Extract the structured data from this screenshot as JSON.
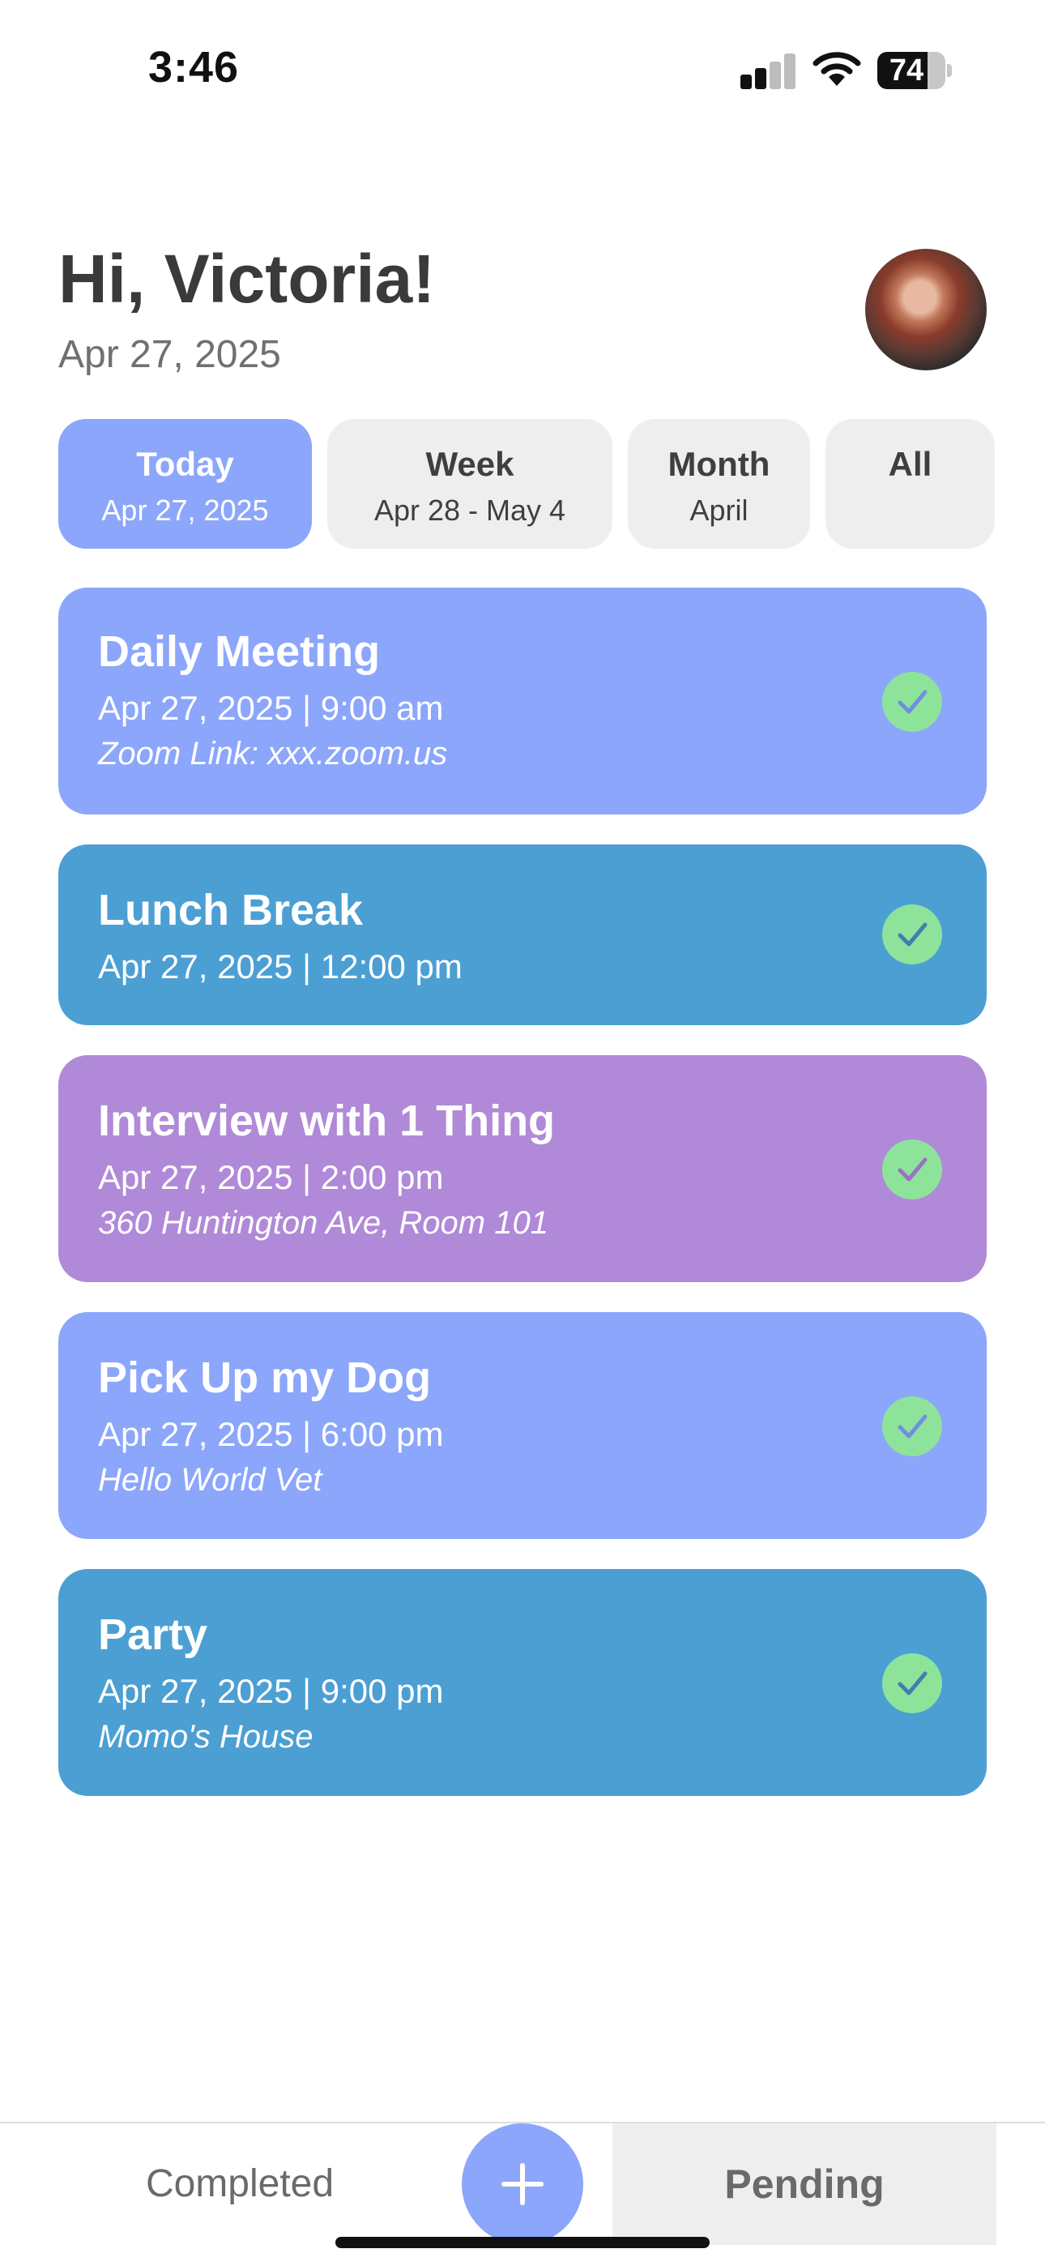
{
  "status_bar": {
    "time": "3:46",
    "battery": "74",
    "battery_level": 0.74
  },
  "header": {
    "greeting": "Hi, Victoria!",
    "date": "Apr 27, 2025"
  },
  "tabs": [
    {
      "label": "Today",
      "sub": "Apr 27, 2025",
      "active": true
    },
    {
      "label": "Week",
      "sub": "Apr 28 - May 4",
      "active": false
    },
    {
      "label": "Month",
      "sub": "April",
      "active": false
    },
    {
      "label": "All",
      "sub": "",
      "active": false
    }
  ],
  "tasks": [
    {
      "title": "Daily Meeting",
      "when": "Apr 27, 2025 | 9:00 am",
      "where": "Zoom Link: xxx.zoom.us",
      "color": "#8ba6fb"
    },
    {
      "title": "Lunch Break",
      "when": "Apr 27, 2025 | 12:00 pm",
      "where": "",
      "color": "#4b9fd3"
    },
    {
      "title": "Interview with 1 Thing",
      "when": "Apr 27, 2025 | 2:00 pm",
      "where": "360 Huntington Ave, Room 101",
      "color": "#b089d8"
    },
    {
      "title": "Pick Up my Dog",
      "when": "Apr 27, 2025 | 6:00 pm",
      "where": "Hello World Vet",
      "color": "#8ba6fb"
    },
    {
      "title": "Party",
      "when": "Apr 27, 2025 | 9:00 pm",
      "where": "Momo's House",
      "color": "#4b9fd3"
    }
  ],
  "bottom_nav": {
    "completed": "Completed",
    "pending": "Pending"
  },
  "icons": {
    "signal": "cellular-signal-icon",
    "wifi": "wifi-icon",
    "check": "check-circle-icon",
    "add": "plus-icon"
  },
  "colors": {
    "accent": "#8ba6fb",
    "check": "#8ee39a",
    "card_blue": "#4b9fd3",
    "card_purple": "#b089d8"
  }
}
